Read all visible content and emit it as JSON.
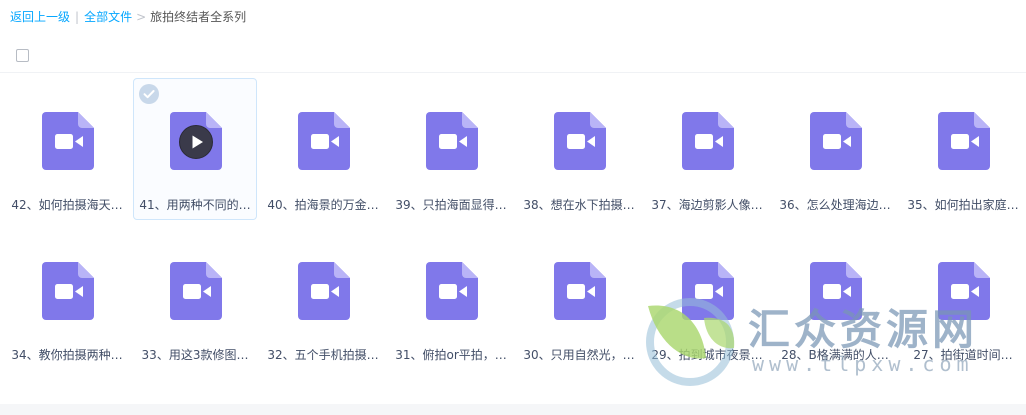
{
  "breadcrumb": {
    "back": "返回上一级",
    "all_files": "全部文件",
    "separator": ">",
    "pipe": "|",
    "current": "旅拍终结者全系列"
  },
  "colors": {
    "accent": "#06a7ff",
    "file_icon": "#8078ea",
    "file_icon_fold": "#b9b4f7"
  },
  "files": [
    {
      "name": "42、如何拍摄海天…",
      "icon": "video-file-icon"
    },
    {
      "name": "41、用两种不同的…",
      "icon": "video-file-icon",
      "selected": true,
      "hover_play": true
    },
    {
      "name": "40、拍海景的万金…",
      "icon": "video-file-icon"
    },
    {
      "name": "39、只拍海面显得…",
      "icon": "video-file-icon"
    },
    {
      "name": "38、想在水下拍摄…",
      "icon": "video-file-icon"
    },
    {
      "name": "37、海边剪影人像…",
      "icon": "video-file-icon"
    },
    {
      "name": "36、怎么处理海边…",
      "icon": "video-file-icon"
    },
    {
      "name": "35、如何拍出家庭…",
      "icon": "video-file-icon"
    },
    {
      "name": "34、教你拍摄两种…",
      "icon": "video-file-icon"
    },
    {
      "name": "33、用这3款修图…",
      "icon": "video-file-icon"
    },
    {
      "name": "32、五个手机拍摄…",
      "icon": "video-file-icon"
    },
    {
      "name": "31、俯拍or平拍，…",
      "icon": "video-file-icon"
    },
    {
      "name": "30、只用自然光，…",
      "icon": "video-file-icon"
    },
    {
      "name": "29、拍到城市夜景…",
      "icon": "video-file-icon"
    },
    {
      "name": "28、B格满满的人…",
      "icon": "video-file-icon"
    },
    {
      "name": "27、拍街道时间…",
      "icon": "video-file-icon"
    }
  ],
  "watermark": {
    "title": "汇众资源网",
    "url": "www.tlpxw.com"
  }
}
